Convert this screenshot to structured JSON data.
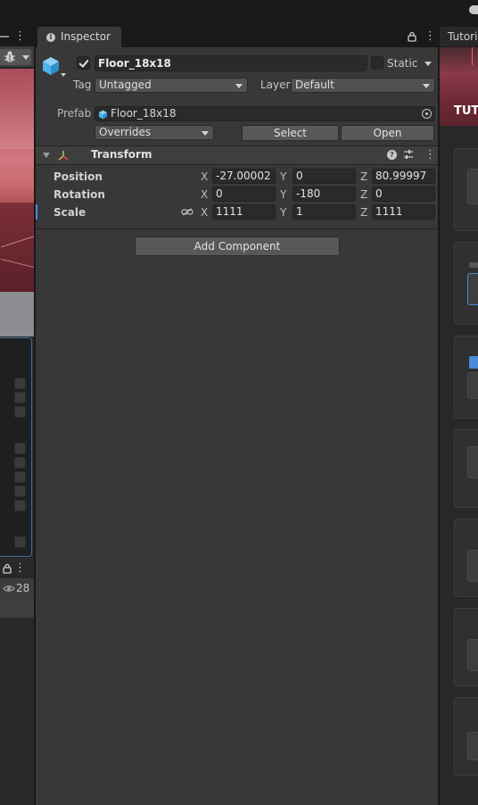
{
  "colors": {
    "accent": "#4a8ad6",
    "cube": "#4fb3e8",
    "panel_bg": "#383838",
    "field_bg": "#2a2a2a",
    "button_bg": "#585858"
  },
  "left_panel": {
    "hierarchy_visible_count": "28"
  },
  "inspector": {
    "tab_label": "Inspector",
    "object_name": "Floor_18x18",
    "static_label": "Static",
    "tag_label": "Tag",
    "tag_value": "Untagged",
    "layer_label": "Layer",
    "layer_value": "Default",
    "prefab_label": "Prefab",
    "prefab_value": "Floor_18x18",
    "overrides_label": "Overrides",
    "select_label": "Select",
    "open_label": "Open",
    "transform": {
      "title": "Transform",
      "position": {
        "label": "Position",
        "x": "-27.00002",
        "y": "0",
        "z": "80.99997"
      },
      "rotation": {
        "label": "Rotation",
        "x": "0",
        "y": "-180",
        "z": "0"
      },
      "scale": {
        "label": "Scale",
        "x": "1111",
        "y": "1",
        "z": "1111"
      },
      "axis_x": "X",
      "axis_y": "Y",
      "axis_z": "Z"
    },
    "add_component_label": "Add Component"
  },
  "right_panel": {
    "tab_label": "Tutorials",
    "banner_title": "TUTORIALS"
  }
}
